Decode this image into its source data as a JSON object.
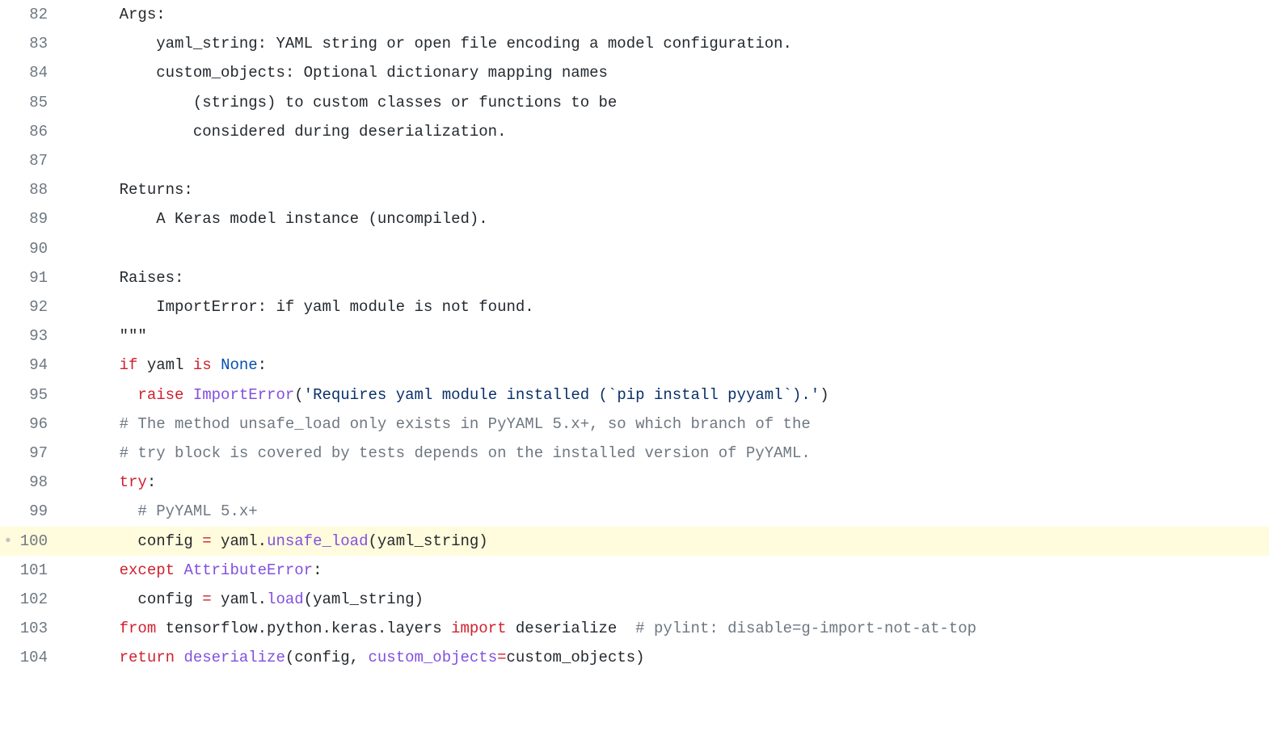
{
  "lines": [
    {
      "num": 82,
      "marker": "",
      "hl": false,
      "tokens": [
        {
          "cls": "text",
          "t": "    Args:"
        }
      ]
    },
    {
      "num": 83,
      "marker": "",
      "hl": false,
      "tokens": [
        {
          "cls": "text",
          "t": "        yaml_string: YAML string or open file encoding a model configuration."
        }
      ]
    },
    {
      "num": 84,
      "marker": "",
      "hl": false,
      "tokens": [
        {
          "cls": "text",
          "t": "        custom_objects: Optional dictionary mapping names"
        }
      ]
    },
    {
      "num": 85,
      "marker": "",
      "hl": false,
      "tokens": [
        {
          "cls": "text",
          "t": "            (strings) to custom classes or functions to be"
        }
      ]
    },
    {
      "num": 86,
      "marker": "",
      "hl": false,
      "tokens": [
        {
          "cls": "text",
          "t": "            considered during deserialization."
        }
      ]
    },
    {
      "num": 87,
      "marker": "",
      "hl": false,
      "tokens": [
        {
          "cls": "text",
          "t": ""
        }
      ]
    },
    {
      "num": 88,
      "marker": "",
      "hl": false,
      "tokens": [
        {
          "cls": "text",
          "t": "    Returns:"
        }
      ]
    },
    {
      "num": 89,
      "marker": "",
      "hl": false,
      "tokens": [
        {
          "cls": "text",
          "t": "        A Keras model instance (uncompiled)."
        }
      ]
    },
    {
      "num": 90,
      "marker": "",
      "hl": false,
      "tokens": [
        {
          "cls": "text",
          "t": ""
        }
      ]
    },
    {
      "num": 91,
      "marker": "",
      "hl": false,
      "tokens": [
        {
          "cls": "text",
          "t": "    Raises:"
        }
      ]
    },
    {
      "num": 92,
      "marker": "",
      "hl": false,
      "tokens": [
        {
          "cls": "text",
          "t": "        ImportError: if yaml module is not found."
        }
      ]
    },
    {
      "num": 93,
      "marker": "",
      "hl": false,
      "tokens": [
        {
          "cls": "text",
          "t": "    \"\"\""
        }
      ]
    },
    {
      "num": 94,
      "marker": "",
      "hl": false,
      "tokens": [
        {
          "cls": "text",
          "t": "    "
        },
        {
          "cls": "kw",
          "t": "if"
        },
        {
          "cls": "text",
          "t": " yaml "
        },
        {
          "cls": "kw",
          "t": "is"
        },
        {
          "cls": "text",
          "t": " "
        },
        {
          "cls": "const",
          "t": "None"
        },
        {
          "cls": "text",
          "t": ":"
        }
      ]
    },
    {
      "num": 95,
      "marker": "",
      "hl": false,
      "tokens": [
        {
          "cls": "text",
          "t": "      "
        },
        {
          "cls": "kw",
          "t": "raise"
        },
        {
          "cls": "text",
          "t": " "
        },
        {
          "cls": "func",
          "t": "ImportError"
        },
        {
          "cls": "text",
          "t": "("
        },
        {
          "cls": "str",
          "t": "'Requires yaml module installed (`pip install pyyaml`).'"
        },
        {
          "cls": "text",
          "t": ")"
        }
      ]
    },
    {
      "num": 96,
      "marker": "",
      "hl": false,
      "tokens": [
        {
          "cls": "text",
          "t": "    "
        },
        {
          "cls": "comment",
          "t": "# The method unsafe_load only exists in PyYAML 5.x+, so which branch of the"
        }
      ]
    },
    {
      "num": 97,
      "marker": "",
      "hl": false,
      "tokens": [
        {
          "cls": "text",
          "t": "    "
        },
        {
          "cls": "comment",
          "t": "# try block is covered by tests depends on the installed version of PyYAML."
        }
      ]
    },
    {
      "num": 98,
      "marker": "",
      "hl": false,
      "tokens": [
        {
          "cls": "text",
          "t": "    "
        },
        {
          "cls": "kw",
          "t": "try"
        },
        {
          "cls": "text",
          "t": ":"
        }
      ]
    },
    {
      "num": 99,
      "marker": "",
      "hl": false,
      "tokens": [
        {
          "cls": "text",
          "t": "      "
        },
        {
          "cls": "comment",
          "t": "# PyYAML 5.x+"
        }
      ]
    },
    {
      "num": 100,
      "marker": "•",
      "hl": true,
      "tokens": [
        {
          "cls": "text",
          "t": "      config "
        },
        {
          "cls": "kw",
          "t": "="
        },
        {
          "cls": "text",
          "t": " yaml."
        },
        {
          "cls": "func",
          "t": "unsafe_load"
        },
        {
          "cls": "text",
          "t": "(yaml_string)"
        }
      ]
    },
    {
      "num": 101,
      "marker": "",
      "hl": false,
      "tokens": [
        {
          "cls": "text",
          "t": "    "
        },
        {
          "cls": "kw",
          "t": "except"
        },
        {
          "cls": "text",
          "t": " "
        },
        {
          "cls": "func",
          "t": "AttributeError"
        },
        {
          "cls": "text",
          "t": ":"
        }
      ]
    },
    {
      "num": 102,
      "marker": "",
      "hl": false,
      "tokens": [
        {
          "cls": "text",
          "t": "      config "
        },
        {
          "cls": "kw",
          "t": "="
        },
        {
          "cls": "text",
          "t": " yaml."
        },
        {
          "cls": "func",
          "t": "load"
        },
        {
          "cls": "text",
          "t": "(yaml_string)"
        }
      ]
    },
    {
      "num": 103,
      "marker": "",
      "hl": false,
      "tokens": [
        {
          "cls": "text",
          "t": "    "
        },
        {
          "cls": "kw",
          "t": "from"
        },
        {
          "cls": "text",
          "t": " tensorflow.python.keras.layers "
        },
        {
          "cls": "kw",
          "t": "import"
        },
        {
          "cls": "text",
          "t": " deserialize  "
        },
        {
          "cls": "comment",
          "t": "# pylint: disable=g-import-not-at-top"
        }
      ]
    },
    {
      "num": 104,
      "marker": "",
      "hl": false,
      "tokens": [
        {
          "cls": "text",
          "t": "    "
        },
        {
          "cls": "kw",
          "t": "return"
        },
        {
          "cls": "text",
          "t": " "
        },
        {
          "cls": "func",
          "t": "deserialize"
        },
        {
          "cls": "text",
          "t": "(config, "
        },
        {
          "cls": "func",
          "t": "custom_objects"
        },
        {
          "cls": "kw",
          "t": "="
        },
        {
          "cls": "text",
          "t": "custom_objects)"
        }
      ]
    }
  ]
}
